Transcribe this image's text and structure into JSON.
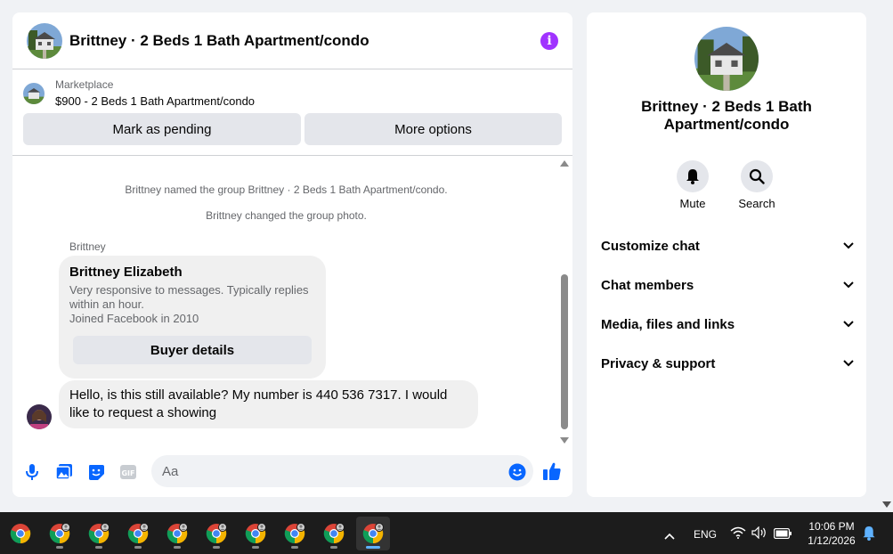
{
  "chat": {
    "title": "Brittney · 2 Beds 1 Bath Apartment/condo",
    "marketplace_label": "Marketplace",
    "listing": "$900 - 2 Beds 1 Bath Apartment/condo",
    "mark_pending_label": "Mark as pending",
    "more_options_label": "More options",
    "system_messages": [
      "Brittney named the group Brittney · 2 Beds 1 Bath Apartment/condo.",
      "Brittney changed the group photo."
    ],
    "sender_name": "Brittney",
    "profile_card": {
      "name": "Brittney Elizabeth",
      "desc_line1": "Very responsive to messages. Typically replies",
      "desc_line2": "within an hour.",
      "joined": "Joined Facebook in 2010",
      "button_label": "Buyer details"
    },
    "message": "Hello, is this still available? My number is 440 536 7317.  I would like to request a showing",
    "composer_placeholder": "Aa",
    "gif_label": "GIF"
  },
  "side": {
    "title": "Brittney · 2 Beds 1 Bath Apartment/condo",
    "mute_label": "Mute",
    "search_label": "Search",
    "rows": [
      "Customize chat",
      "Chat members",
      "Media, files and links",
      "Privacy & support"
    ]
  },
  "taskbar": {
    "lang": "ENG",
    "time": "10:06 PM",
    "date": "1/12/2026"
  },
  "colors": {
    "accent": "#0866ff",
    "info": "#a033ff"
  }
}
